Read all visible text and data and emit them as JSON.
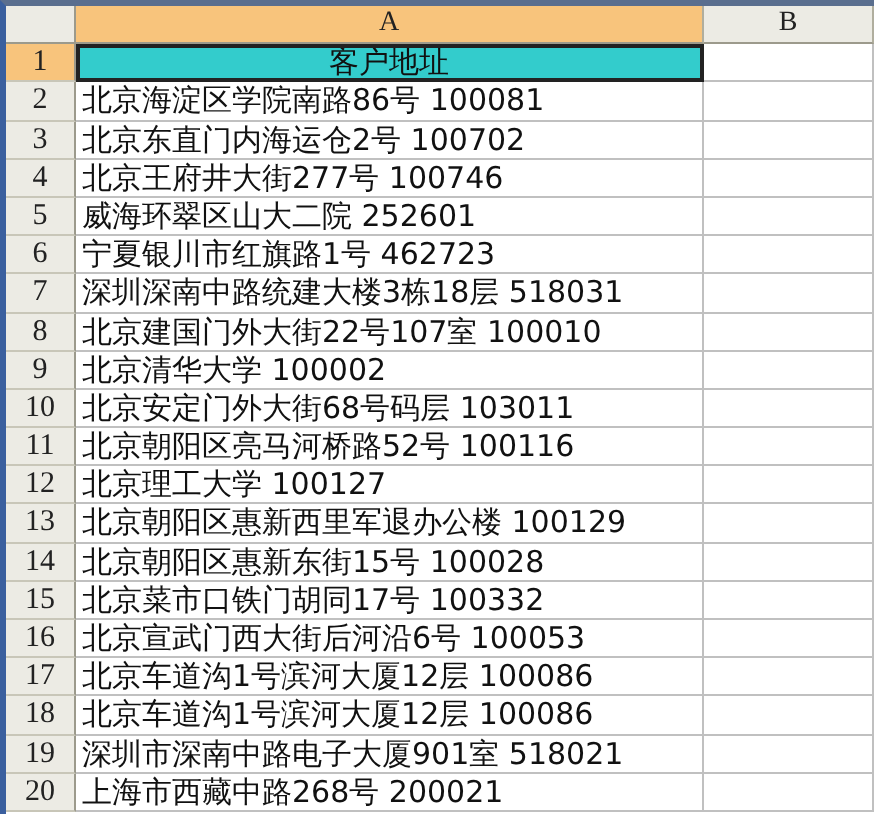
{
  "columns": [
    {
      "label": "A",
      "selected": true
    },
    {
      "label": "B",
      "selected": false
    }
  ],
  "rows": [
    {
      "number": "1",
      "selected": true,
      "cells": [
        "客户地址",
        ""
      ]
    },
    {
      "number": "2",
      "selected": false,
      "cells": [
        "北京海淀区学院南路86号  100081",
        ""
      ]
    },
    {
      "number": "3",
      "selected": false,
      "cells": [
        "北京东直门内海运仓2号  100702",
        ""
      ]
    },
    {
      "number": "4",
      "selected": false,
      "cells": [
        "北京王府井大街277号  100746",
        ""
      ]
    },
    {
      "number": "5",
      "selected": false,
      "cells": [
        "威海环翠区山大二院  252601",
        ""
      ]
    },
    {
      "number": "6",
      "selected": false,
      "cells": [
        "宁夏银川市红旗路1号  462723",
        ""
      ]
    },
    {
      "number": "7",
      "selected": false,
      "cells": [
        "深圳深南中路统建大楼3栋18层  518031",
        ""
      ]
    },
    {
      "number": "8",
      "selected": false,
      "cells": [
        "北京建国门外大街22号107室  100010",
        ""
      ]
    },
    {
      "number": "9",
      "selected": false,
      "cells": [
        "北京清华大学  100002",
        ""
      ]
    },
    {
      "number": "10",
      "selected": false,
      "cells": [
        "北京安定门外大街68号码层  103011",
        ""
      ]
    },
    {
      "number": "11",
      "selected": false,
      "cells": [
        "北京朝阳区亮马河桥路52号  100116",
        ""
      ]
    },
    {
      "number": "12",
      "selected": false,
      "cells": [
        "北京理工大学  100127",
        ""
      ]
    },
    {
      "number": "13",
      "selected": false,
      "cells": [
        "北京朝阳区惠新西里军退办公楼  100129",
        ""
      ]
    },
    {
      "number": "14",
      "selected": false,
      "cells": [
        "北京朝阳区惠新东街15号  100028",
        ""
      ]
    },
    {
      "number": "15",
      "selected": false,
      "cells": [
        "北京菜市口铁门胡同17号  100332",
        ""
      ]
    },
    {
      "number": "16",
      "selected": false,
      "cells": [
        "北京宣武门西大街后河沿6号  100053",
        ""
      ]
    },
    {
      "number": "17",
      "selected": false,
      "cells": [
        "北京车道沟1号滨河大厦12层  100086",
        ""
      ]
    },
    {
      "number": "18",
      "selected": false,
      "cells": [
        "北京车道沟1号滨河大厦12层  100086",
        ""
      ]
    },
    {
      "number": "19",
      "selected": false,
      "cells": [
        "深圳市深南中路电子大厦901室  518021",
        ""
      ]
    },
    {
      "number": "20",
      "selected": false,
      "cells": [
        "上海市西藏中路268号  200021",
        ""
      ]
    }
  ]
}
